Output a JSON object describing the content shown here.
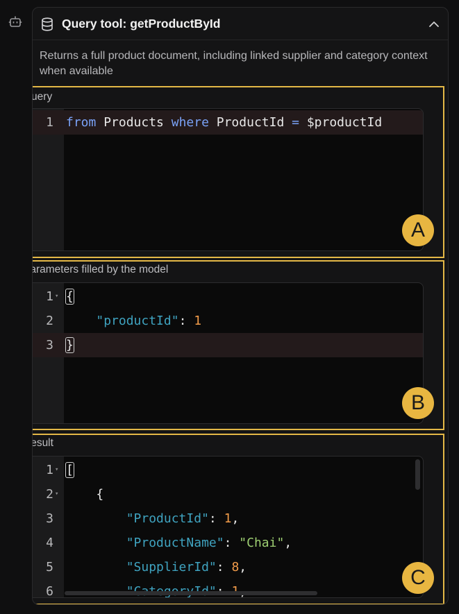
{
  "panel": {
    "title": "Query tool: getProductById",
    "description": "Returns a full product document, including linked supplier and category context when available"
  },
  "icons": {
    "left_rail": "robot-icon",
    "header": "database-icon",
    "collapse": "chevron-up-icon"
  },
  "query_section": {
    "label": "Query",
    "badge": "A",
    "lines": [
      {
        "num": "1",
        "tokens": [
          {
            "t": "from",
            "c": "kw"
          },
          {
            "t": " Products ",
            "c": ""
          },
          {
            "t": "where",
            "c": "kw"
          },
          {
            "t": " ProductId ",
            "c": ""
          },
          {
            "t": "=",
            "c": "kw"
          },
          {
            "t": " $productId",
            "c": ""
          }
        ]
      }
    ]
  },
  "params_section": {
    "label": "Parameters filled by the model",
    "badge": "B",
    "lines": [
      {
        "num": "1",
        "tokens": [
          {
            "t": "{",
            "c": "bracket"
          }
        ]
      },
      {
        "num": "2",
        "tokens": [
          {
            "t": "    ",
            "c": ""
          },
          {
            "t": "\"productId\"",
            "c": "prop"
          },
          {
            "t": ": ",
            "c": ""
          },
          {
            "t": "1",
            "c": "num"
          }
        ]
      },
      {
        "num": "3",
        "tokens": [
          {
            "t": "}",
            "c": "bracket"
          }
        ]
      }
    ]
  },
  "result_section": {
    "label": "Result",
    "badge": "C",
    "lines": [
      {
        "num": "1",
        "tokens": [
          {
            "t": "[",
            "c": "bracket"
          }
        ]
      },
      {
        "num": "2",
        "tokens": [
          {
            "t": "    {",
            "c": ""
          }
        ]
      },
      {
        "num": "3",
        "tokens": [
          {
            "t": "        ",
            "c": ""
          },
          {
            "t": "\"ProductId\"",
            "c": "prop"
          },
          {
            "t": ": ",
            "c": ""
          },
          {
            "t": "1",
            "c": "num"
          },
          {
            "t": ",",
            "c": ""
          }
        ]
      },
      {
        "num": "4",
        "tokens": [
          {
            "t": "        ",
            "c": ""
          },
          {
            "t": "\"ProductName\"",
            "c": "prop"
          },
          {
            "t": ": ",
            "c": ""
          },
          {
            "t": "\"Chai\"",
            "c": "str"
          },
          {
            "t": ",",
            "c": ""
          }
        ]
      },
      {
        "num": "5",
        "tokens": [
          {
            "t": "        ",
            "c": ""
          },
          {
            "t": "\"SupplierId\"",
            "c": "prop"
          },
          {
            "t": ": ",
            "c": ""
          },
          {
            "t": "8",
            "c": "num"
          },
          {
            "t": ",",
            "c": ""
          }
        ]
      },
      {
        "num": "6",
        "tokens": [
          {
            "t": "        ",
            "c": ""
          },
          {
            "t": "\"CategoryId\"",
            "c": "prop"
          },
          {
            "t": ": ",
            "c": ""
          },
          {
            "t": "1",
            "c": "num"
          },
          {
            "t": ",",
            "c": ""
          }
        ]
      }
    ]
  },
  "colors": {
    "highlight_border": "#e4b847",
    "badge": "#e8b641",
    "keyword": "#7aa2f7",
    "property": "#3fa3c0",
    "number": "#f29c4a",
    "string": "#9ecf72"
  }
}
